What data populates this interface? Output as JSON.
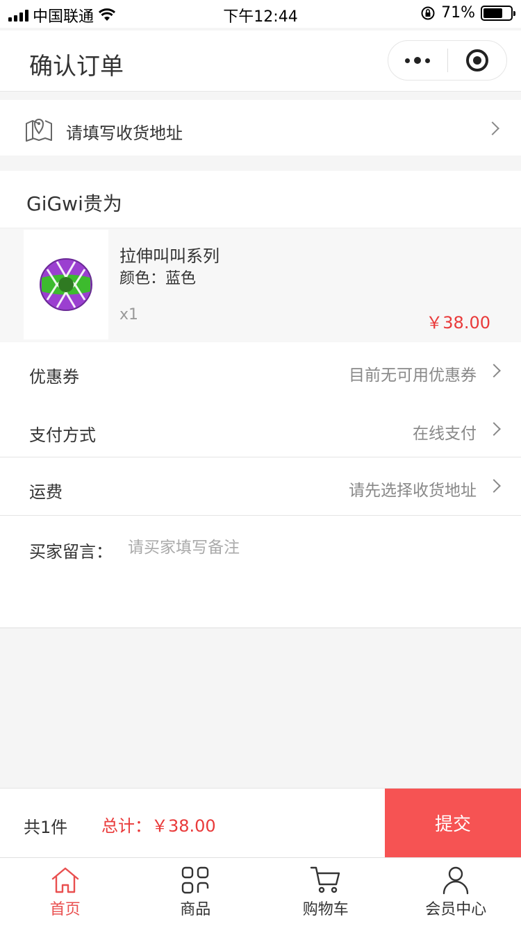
{
  "status_bar": {
    "carrier": "中国联通",
    "time": "下午12:44",
    "battery_text": "71%",
    "battery_level": 0.71
  },
  "header": {
    "title": "确认订单",
    "more_icon": "more-dots-icon",
    "close_icon": "target-circle-icon"
  },
  "address": {
    "icon": "map-icon",
    "placeholder_text": "请填写收货地址"
  },
  "shop": {
    "name": "GiGwi贵为"
  },
  "product": {
    "name": "拉伸叫叫系列",
    "spec": "颜色：蓝色",
    "quantity": "x1",
    "price": "￥38.00"
  },
  "options": {
    "coupon": {
      "label": "优惠券",
      "value": "目前无可用优惠券"
    },
    "payment": {
      "label": "支付方式",
      "value": "在线支付"
    },
    "shipping": {
      "label": "运费",
      "value": "请先选择收货地址"
    }
  },
  "message": {
    "label": "买家留言：",
    "placeholder": "请买家填写备注"
  },
  "submit_bar": {
    "count": "共1件",
    "total": "总计：￥38.00",
    "submit_label": "提交"
  },
  "tabs": [
    {
      "label": "首页",
      "icon": "home-icon",
      "active": true
    },
    {
      "label": "商品",
      "icon": "grid-icon",
      "active": false
    },
    {
      "label": "购物车",
      "icon": "cart-icon",
      "active": false
    },
    {
      "label": "会员中心",
      "icon": "user-icon",
      "active": false
    }
  ],
  "colors": {
    "accent_red": "#e93a3a",
    "submit_bg": "#f65353",
    "background": "#f5f5f5"
  }
}
